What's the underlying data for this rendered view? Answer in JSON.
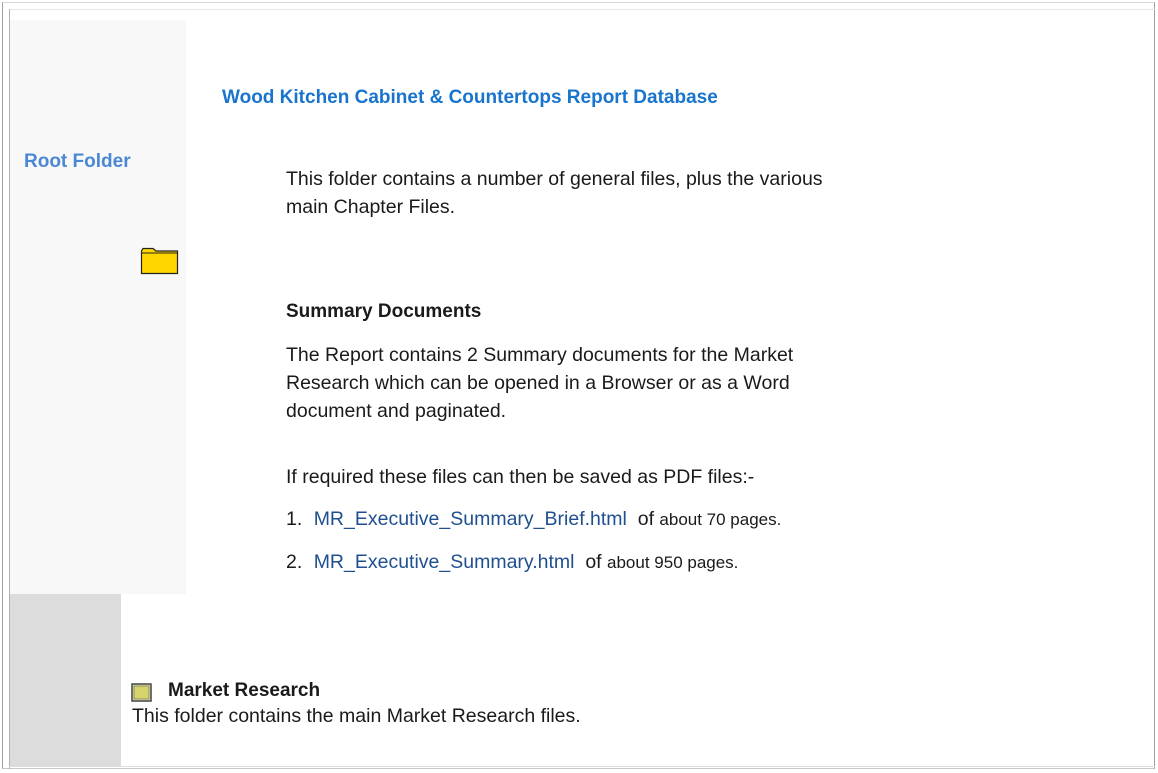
{
  "sidebar": {
    "root_label": "Root Folder"
  },
  "header": {
    "title": "Wood Kitchen Cabinet & Countertops Report Database"
  },
  "root": {
    "intro": "This folder contains a number of general files, plus the various main Chapter Files."
  },
  "summary": {
    "heading": "Summary Documents",
    "description": "The Report contains 2 Summary documents for the Market Research which can be opened in a Browser or as a Word document and paginated.",
    "pdf_note": "If required these files can then be saved as PDF files:-",
    "items": [
      {
        "number": "1.",
        "link": "MR_Executive_Summary_Brief.html",
        "of": "of",
        "pages": "about 70 pages."
      },
      {
        "number": "2.",
        "link": "MR_Executive_Summary.html",
        "of": "of",
        "pages": "about 950 pages."
      }
    ]
  },
  "market_research": {
    "heading": "Market Research",
    "description": "This folder contains the main Market Research files."
  },
  "colors": {
    "root_label": "#4a88d6",
    "title": "#1874cd",
    "link": "#1f4f8f",
    "folder_fill": "#ffd700"
  },
  "icons": {
    "root_folder": "folder-icon",
    "market_research_folder": "folder-icon"
  }
}
